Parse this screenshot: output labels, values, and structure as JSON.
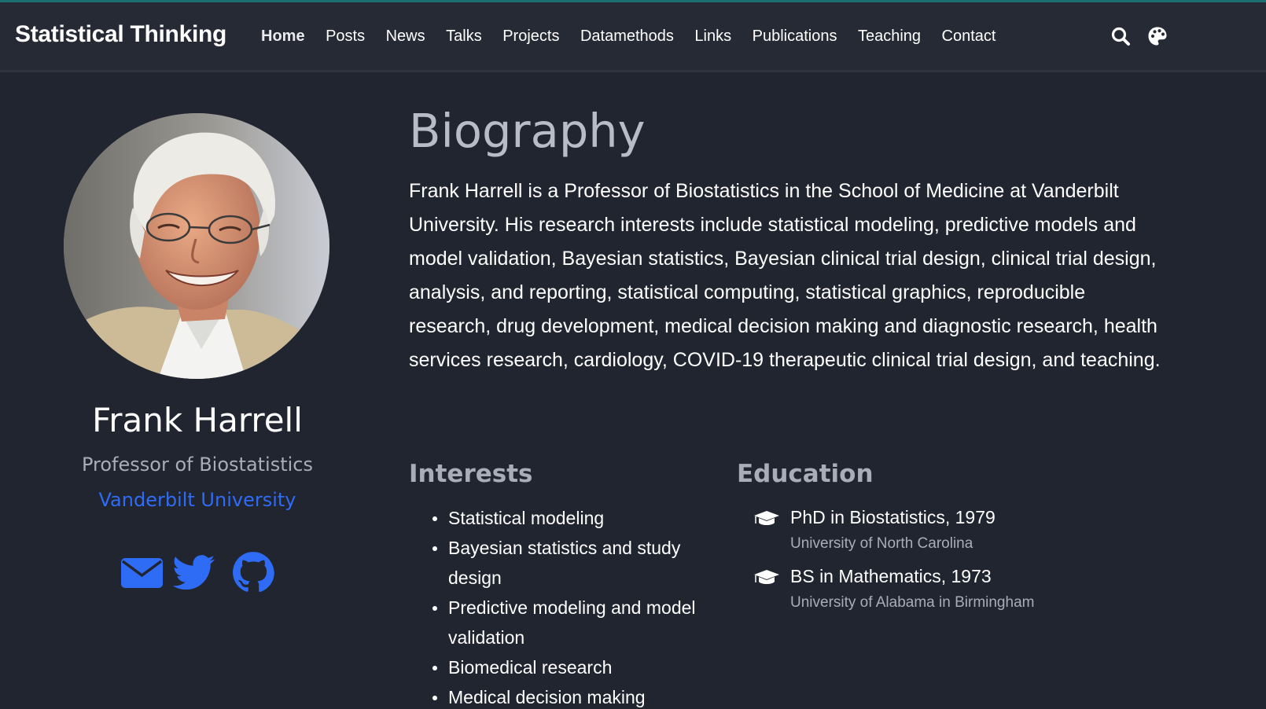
{
  "brand": "Statistical Thinking",
  "nav": [
    "Home",
    "Posts",
    "News",
    "Talks",
    "Projects",
    "Datamethods",
    "Links",
    "Publications",
    "Teaching",
    "Contact"
  ],
  "nav_active": "Home",
  "nav_icons": [
    "search-icon",
    "palette-icon"
  ],
  "profile": {
    "name": "Frank Harrell",
    "role": "Professor of Biostatistics",
    "organization": "Vanderbilt University",
    "social_icons": [
      "envelope-icon",
      "twitter-icon",
      "github-icon"
    ]
  },
  "biography": {
    "title": "Biography",
    "text": "Frank Harrell is a Professor of Biostatistics in the School of Medicine at Vanderbilt University. His research interests include statistical modeling, predictive models and model validation, Bayesian statistics, Bayesian clinical trial design, clinical trial design, analysis, and reporting, statistical computing, statistical graphics, reproducible research, drug development, medical decision making and diagnostic research, health services research, cardiology, COVID-19 therapeutic clinical trial design, and teaching."
  },
  "interests": {
    "title": "Interests",
    "items": [
      "Statistical modeling",
      "Bayesian statistics and study design",
      "Predictive modeling and model validation",
      "Biomedical research",
      "Medical decision making"
    ]
  },
  "education": {
    "title": "Education",
    "items": [
      {
        "degree": "PhD in Biostatistics, 1979",
        "institution": "University of North Carolina"
      },
      {
        "degree": "BS in Mathematics, 1973",
        "institution": "University of Alabama in Birmingham"
      }
    ]
  },
  "colors": {
    "background": "#212530",
    "navbar": "#262a35",
    "accent": "#2f6cf5",
    "muted": "#a8adb8",
    "topline": "#1b6f73"
  }
}
